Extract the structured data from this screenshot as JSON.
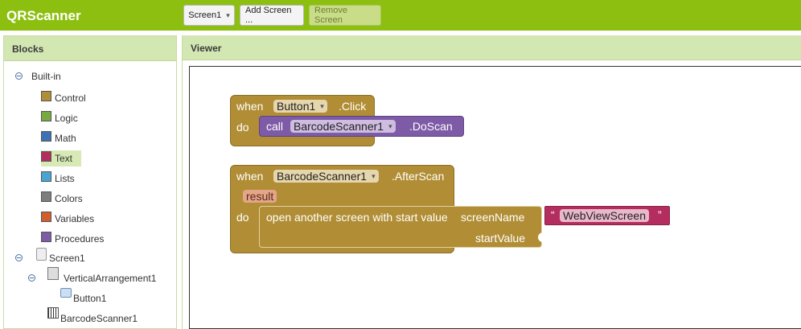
{
  "app": {
    "title": "QRScanner"
  },
  "toolbar": {
    "screen_select": "Screen1",
    "screen_select_arrow": "▾",
    "add_screen": "Add Screen ...",
    "remove_screen": "Remove Screen"
  },
  "blocks": {
    "header": "Blocks",
    "builtin_label": "Built-in",
    "builtin": [
      {
        "label": "Control",
        "color": "#b18e35"
      },
      {
        "label": "Logic",
        "color": "#77ab41"
      },
      {
        "label": "Math",
        "color": "#3f71b5"
      },
      {
        "label": "Text",
        "color": "#b32d5e"
      },
      {
        "label": "Lists",
        "color": "#49a6d4"
      },
      {
        "label": "Colors",
        "color": "#7d7d7d"
      },
      {
        "label": "Variables",
        "color": "#d05f2d"
      },
      {
        "label": "Procedures",
        "color": "#7d5ba6"
      }
    ],
    "components": {
      "screen": "Screen1",
      "arrangement": "VerticalArrangement1",
      "button": "Button1",
      "scanner": "BarcodeScanner1"
    }
  },
  "viewer": {
    "header": "Viewer",
    "block1": {
      "when": "when",
      "component": "Button1",
      "event": ".Click",
      "do": "do",
      "call": "call",
      "target": "BarcodeScanner1",
      "method": ".DoScan"
    },
    "block2": {
      "when": "when",
      "component": "BarcodeScanner1",
      "event": ".AfterScan",
      "param": "result",
      "do": "do",
      "action": "open another screen with start value",
      "arg1": "screenName",
      "arg2": "startValue",
      "quote_open": "“",
      "string_value": "WebViewScreen",
      "quote_close": "”"
    },
    "dropdown_arrow": "▾"
  },
  "colors": {
    "topbar": "#8dbf11",
    "panel_header": "#d3e7b2",
    "control_block": "#b18e35",
    "component_block": "#7d5ba6",
    "text_block": "#b32d5e"
  }
}
